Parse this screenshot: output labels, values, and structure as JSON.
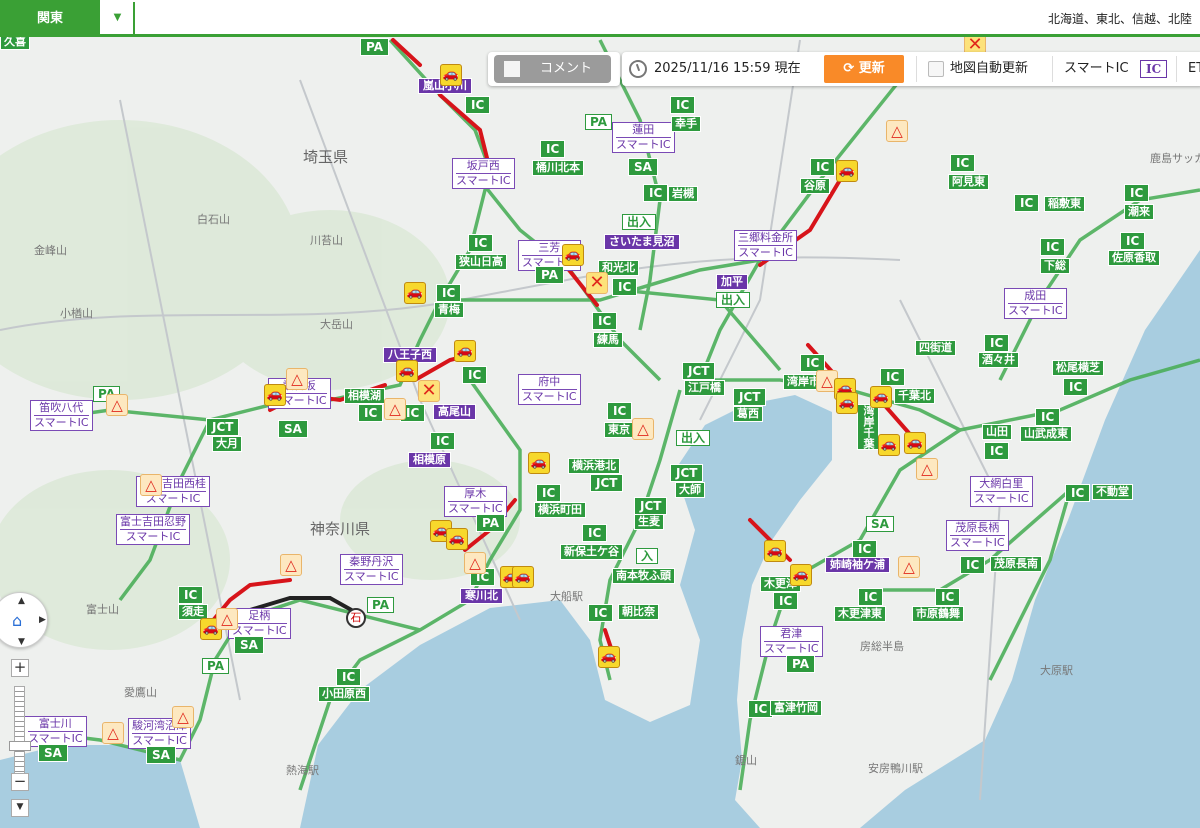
{
  "header": {
    "region": "関東",
    "other_regions": "北海道、東北、信越、北陸"
  },
  "toolbar": {
    "comment_label": "コメント",
    "timestamp": "2025/11/16 15:59 現在",
    "refresh_label": "更新",
    "auto_update_label": "地図自動更新",
    "smart_ic_label": "スマートIC",
    "smart_ic_badge": "IC",
    "etc_label": "ET"
  },
  "map_controls": {
    "zoom_in": "+",
    "zoom_out": "−",
    "zoom_level_fraction": 0.6
  },
  "map": {
    "labels": [
      {
        "type": "nm",
        "text": "久喜"
      },
      {
        "type": "ic",
        "text": "PA"
      },
      {
        "type": "pu",
        "text": "嵐山小川"
      },
      {
        "type": "ic",
        "text": "IC"
      },
      {
        "type": "ol",
        "text": "PA"
      },
      {
        "type": "ic",
        "text": "IC"
      },
      {
        "type": "nm",
        "text": "桶川北本"
      },
      {
        "type": "sm",
        "text": "蓮田",
        "sub": "スマートIC"
      },
      {
        "type": "ic",
        "text": "SA"
      },
      {
        "type": "ic",
        "text": "IC"
      },
      {
        "type": "nm",
        "text": "幸手"
      },
      {
        "type": "ic",
        "text": "IC"
      },
      {
        "type": "nm",
        "text": "岩槻"
      },
      {
        "type": "sm",
        "text": "坂戸西",
        "sub": "スマートIC"
      },
      {
        "type": "ic",
        "text": "IC"
      },
      {
        "type": "nm",
        "text": "狭山日高"
      },
      {
        "type": "ol",
        "text": "出入"
      },
      {
        "type": "pu",
        "text": "さいたま見沼"
      },
      {
        "type": "sm",
        "text": "三芳",
        "sub": "スマートIC"
      },
      {
        "type": "ic",
        "text": "PA"
      },
      {
        "type": "nm",
        "text": "和光北"
      },
      {
        "type": "ic",
        "text": "IC"
      },
      {
        "type": "ic",
        "text": "IC"
      },
      {
        "type": "nm",
        "text": "青梅"
      },
      {
        "type": "ic",
        "text": "IC"
      },
      {
        "type": "nm",
        "text": "練馬"
      },
      {
        "type": "sm",
        "text": "三郷料金所",
        "sub": "スマートIC"
      },
      {
        "type": "pu",
        "text": "加平"
      },
      {
        "type": "ol",
        "text": "出入"
      },
      {
        "type": "ic",
        "text": "IC"
      },
      {
        "type": "nm",
        "text": "谷原"
      },
      {
        "type": "ic",
        "text": "IC"
      },
      {
        "type": "nm",
        "text": "阿見東"
      },
      {
        "type": "ic",
        "text": "IC"
      },
      {
        "type": "nm",
        "text": "稲敷東"
      },
      {
        "type": "ic",
        "text": "IC"
      },
      {
        "type": "nm",
        "text": "潮来"
      },
      {
        "type": "ic",
        "text": "IC"
      },
      {
        "type": "nm",
        "text": "下総"
      },
      {
        "type": "ic",
        "text": "IC"
      },
      {
        "type": "nm",
        "text": "佐原香取"
      },
      {
        "type": "sm",
        "text": "成田",
        "sub": "スマートIC"
      },
      {
        "type": "nm",
        "text": "四街道"
      },
      {
        "type": "ic",
        "text": "IC"
      },
      {
        "type": "nm",
        "text": "酒々井"
      },
      {
        "type": "nm",
        "text": "松尾横芝"
      },
      {
        "type": "ic",
        "text": "IC"
      },
      {
        "type": "nm",
        "text": "山田"
      },
      {
        "type": "ic",
        "text": "IC"
      },
      {
        "type": "nm",
        "text": "山武成東"
      },
      {
        "type": "ic",
        "text": "IC"
      },
      {
        "type": "ic",
        "text": "IC"
      },
      {
        "type": "nm",
        "text": "不動堂"
      },
      {
        "type": "sm",
        "text": "大網白里",
        "sub": "スマートIC"
      },
      {
        "type": "sm",
        "text": "茂原長柄",
        "sub": "スマートIC"
      },
      {
        "type": "ic",
        "text": "IC"
      },
      {
        "type": "nm",
        "text": "茂原長南"
      },
      {
        "type": "ol",
        "text": "SA"
      },
      {
        "type": "ic",
        "text": "IC"
      },
      {
        "type": "pu",
        "text": "姉崎袖ケ浦"
      },
      {
        "type": "nm",
        "text": "木更津"
      },
      {
        "type": "ic",
        "text": "IC"
      },
      {
        "type": "ic",
        "text": "IC"
      },
      {
        "type": "nm",
        "text": "木更津東"
      },
      {
        "type": "ic",
        "text": "IC"
      },
      {
        "type": "nm",
        "text": "市原鶴舞"
      },
      {
        "type": "sm",
        "text": "君津",
        "sub": "スマートIC"
      },
      {
        "type": "ic",
        "text": "PA"
      },
      {
        "type": "ic",
        "text": "IC"
      },
      {
        "type": "nm",
        "text": "富津竹岡"
      },
      {
        "type": "ic",
        "text": "IC"
      },
      {
        "type": "nm",
        "text": "湾岸市川"
      },
      {
        "type": "ic",
        "text": "JCT"
      },
      {
        "type": "nm",
        "text": "葛西"
      },
      {
        "type": "ic",
        "text": "IC"
      },
      {
        "type": "nm",
        "text": "千葉北"
      },
      {
        "type": "nm",
        "text": "湾岸千葉"
      },
      {
        "type": "ic",
        "text": "JCT"
      },
      {
        "type": "nm",
        "text": "江戸橋"
      },
      {
        "type": "ic",
        "text": "IC"
      },
      {
        "type": "nm",
        "text": "東京"
      },
      {
        "type": "ol",
        "text": "出入"
      },
      {
        "type": "sm",
        "text": "府中",
        "sub": "スマートIC"
      },
      {
        "type": "pu",
        "text": "八王子西"
      },
      {
        "type": "ic",
        "text": "IC"
      },
      {
        "type": "ic",
        "text": "IC"
      },
      {
        "type": "pu",
        "text": "高尾山"
      },
      {
        "type": "nm",
        "text": "相模湖"
      },
      {
        "type": "ic",
        "text": "IC"
      },
      {
        "type": "sm",
        "text": "談合坂",
        "sub": "スマートIC"
      },
      {
        "type": "ic",
        "text": "SA"
      },
      {
        "type": "ic",
        "text": "JCT"
      },
      {
        "type": "nm",
        "text": "大月"
      },
      {
        "type": "sm",
        "text": "笛吹八代",
        "sub": "スマートIC"
      },
      {
        "type": "ol",
        "text": "PA"
      },
      {
        "type": "ic",
        "text": "IC"
      },
      {
        "type": "pu",
        "text": "相模原"
      },
      {
        "type": "nm",
        "text": "横浜港北"
      },
      {
        "type": "ic",
        "text": "JCT"
      },
      {
        "type": "ic",
        "text": "IC"
      },
      {
        "type": "nm",
        "text": "横浜町田"
      },
      {
        "type": "sm",
        "text": "厚木",
        "sub": "スマートIC"
      },
      {
        "type": "ic",
        "text": "PA"
      },
      {
        "type": "ic",
        "text": "JCT"
      },
      {
        "type": "nm",
        "text": "大師"
      },
      {
        "type": "ic",
        "text": "JCT"
      },
      {
        "type": "nm",
        "text": "生麦"
      },
      {
        "type": "ic",
        "text": "IC"
      },
      {
        "type": "nm",
        "text": "新保土ケ谷"
      },
      {
        "type": "ol",
        "text": "入"
      },
      {
        "type": "nm",
        "text": "南本牧ふ頭"
      },
      {
        "type": "ic",
        "text": "IC"
      },
      {
        "type": "nm",
        "text": "朝比奈"
      },
      {
        "type": "ic",
        "text": "IC"
      },
      {
        "type": "pu",
        "text": "寒川北"
      },
      {
        "type": "sm",
        "text": "秦野丹沢",
        "sub": "スマートIC"
      },
      {
        "type": "ol",
        "text": "PA"
      },
      {
        "type": "ic",
        "text": "IC"
      },
      {
        "type": "nm",
        "text": "須走"
      },
      {
        "type": "sm",
        "text": "足柄",
        "sub": "スマートIC"
      },
      {
        "type": "ic",
        "text": "SA"
      },
      {
        "type": "ol",
        "text": "PA"
      },
      {
        "type": "ic",
        "text": "IC"
      },
      {
        "type": "nm",
        "text": "小田原西"
      },
      {
        "type": "sm",
        "text": "富士吉田西桂",
        "sub": "スマートIC"
      },
      {
        "type": "sm",
        "text": "富士吉田忍野",
        "sub": "スマートIC"
      },
      {
        "type": "sm",
        "text": "富士川",
        "sub": "スマートIC"
      },
      {
        "type": "ic",
        "text": "SA"
      },
      {
        "type": "sm",
        "text": "駿河湾沼津",
        "sub": "スマートIC"
      },
      {
        "type": "ic",
        "text": "SA"
      },
      {
        "type": "big",
        "text": "埼玉県"
      },
      {
        "type": "big",
        "text": "神奈川県"
      },
      {
        "type": "pl",
        "text": "白石山"
      },
      {
        "type": "pl",
        "text": "金峰山"
      },
      {
        "type": "pl",
        "text": "川苔山"
      },
      {
        "type": "pl",
        "text": "大岳山"
      },
      {
        "type": "pl",
        "text": "小楢山"
      },
      {
        "type": "pl",
        "text": "富士山"
      },
      {
        "type": "pl",
        "text": "愛鷹山"
      },
      {
        "type": "pl",
        "text": "房総半島"
      },
      {
        "type": "pl",
        "text": "大原駅"
      },
      {
        "type": "pl",
        "text": "安房鴨川駅"
      },
      {
        "type": "pl",
        "text": "鋸山"
      },
      {
        "type": "pl",
        "text": "熱海駅"
      },
      {
        "type": "pl",
        "text": "大船駅"
      },
      {
        "type": "pl",
        "text": "鹿島サッカー"
      }
    ]
  }
}
